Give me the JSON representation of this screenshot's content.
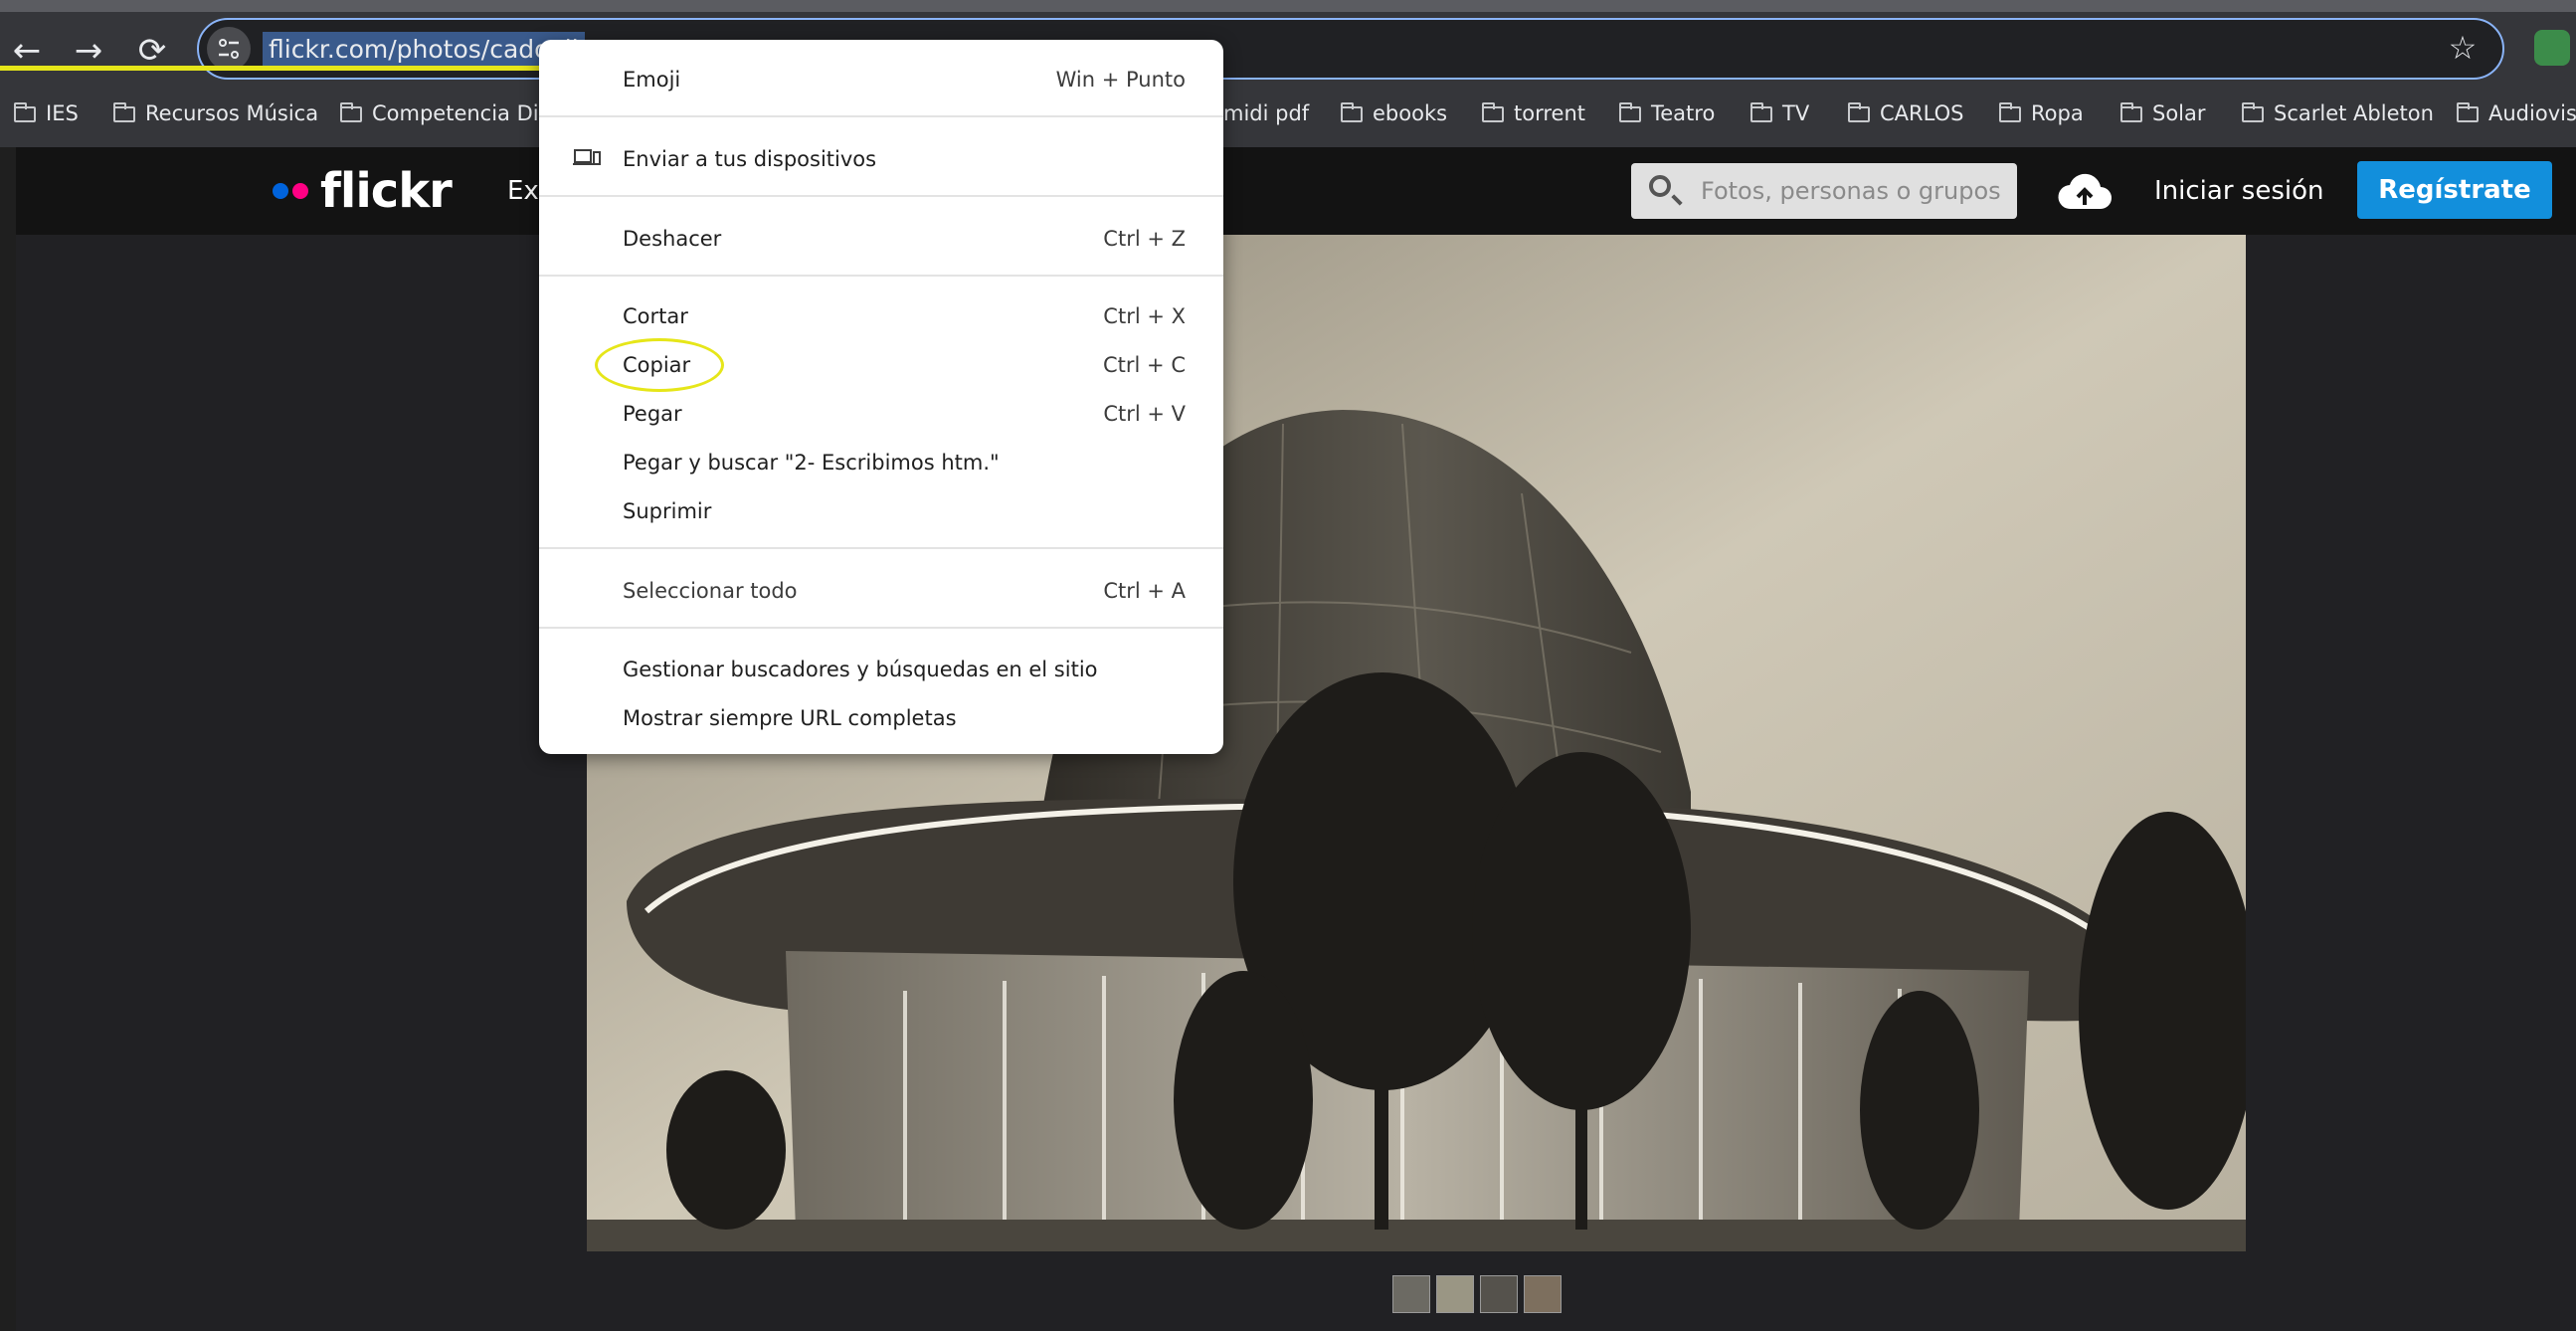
{
  "browser": {
    "url": "flickr.com/photos/cadoall",
    "nav": {
      "back": "←",
      "forward": "→",
      "reload": "⟳"
    },
    "bookmarks": [
      "IES",
      "Recursos Música",
      "Competencia Dig",
      "midi pdf",
      "ebooks",
      "torrent",
      "Teatro",
      "TV",
      "CARLOS",
      "Ropa",
      "Solar",
      "Scarlet Ableton",
      "Audiovis"
    ],
    "star_icon": "☆",
    "colors": {
      "chrome": "#35363a",
      "annotation": "#e6e619"
    }
  },
  "flickr": {
    "logo": "flickr",
    "explore": "Ex",
    "search_placeholder": "Fotos, personas o grupos",
    "signin": "Iniciar sesión",
    "signup": "Regístrate",
    "colors": {
      "brand_blue": "#0063dc",
      "brand_pink": "#ff0084",
      "signup_bg": "#128fdc"
    }
  },
  "context_menu": {
    "emoji": {
      "label": "Emoji",
      "shortcut": "Win + Punto"
    },
    "send": {
      "label": "Enviar a tus dispositivos"
    },
    "undo": {
      "label": "Deshacer",
      "shortcut": "Ctrl + Z"
    },
    "cut": {
      "label": "Cortar",
      "shortcut": "Ctrl + X"
    },
    "copy": {
      "label": "Copiar",
      "shortcut": "Ctrl + C"
    },
    "paste": {
      "label": "Pegar",
      "shortcut": "Ctrl + V"
    },
    "paste_search": {
      "label": "Pegar y buscar \"2- Escribimos htm.\""
    },
    "delete": {
      "label": "Suprimir"
    },
    "select_all": {
      "label": "Seleccionar todo",
      "shortcut": "Ctrl + A"
    },
    "manage_search": {
      "label": "Gestionar buscadores y búsquedas en el sitio"
    },
    "show_full_url": {
      "label": "Mostrar siempre URL completas"
    }
  }
}
